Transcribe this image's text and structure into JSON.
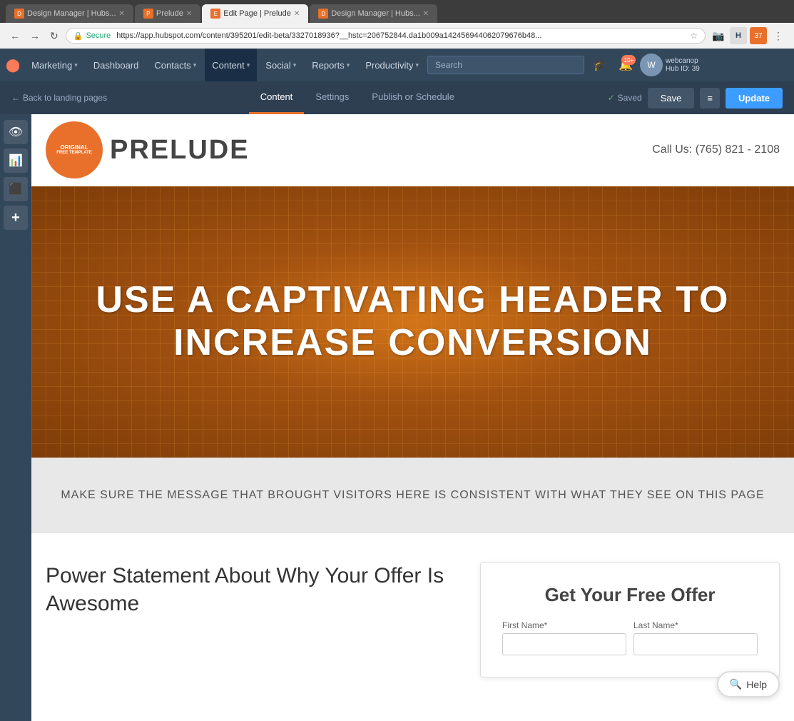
{
  "browser": {
    "tabs": [
      {
        "id": "tab1",
        "label": "Design Manager | Hubs...",
        "active": false,
        "favicon": "D"
      },
      {
        "id": "tab2",
        "label": "Prelude",
        "active": false,
        "favicon": "P"
      },
      {
        "id": "tab3",
        "label": "Edit Page | Prelude",
        "active": true,
        "favicon": "E"
      },
      {
        "id": "tab4",
        "label": "Design Manager | Hubs...",
        "active": false,
        "favicon": "D"
      }
    ],
    "address": {
      "secure_label": "Secure",
      "url": "https://app.hubspot.com/content/395201/edit-beta/3327018936?__hstc=206752844.da1b009a142456944062079676b48..."
    }
  },
  "nav": {
    "logo_symbol": "⬤",
    "items": [
      {
        "id": "marketing",
        "label": "Marketing",
        "has_dropdown": true
      },
      {
        "id": "dashboard",
        "label": "Dashboard",
        "has_dropdown": false
      },
      {
        "id": "contacts",
        "label": "Contacts",
        "has_dropdown": true
      },
      {
        "id": "content",
        "label": "Content",
        "has_dropdown": true,
        "active": true
      },
      {
        "id": "social",
        "label": "Social",
        "has_dropdown": true
      },
      {
        "id": "reports",
        "label": "Reports",
        "has_dropdown": true
      },
      {
        "id": "productivity",
        "label": "Productivity",
        "has_dropdown": true
      }
    ],
    "search_placeholder": "Search",
    "notifications_count": "10+",
    "user": {
      "hub_id": "Hub ID: 39",
      "username": "webcanop"
    }
  },
  "toolbar": {
    "back_label": "Back to landing pages",
    "tabs": [
      {
        "id": "content",
        "label": "Content",
        "active": true
      },
      {
        "id": "settings",
        "label": "Settings",
        "active": false
      },
      {
        "id": "publish",
        "label": "Publish or Schedule",
        "active": false
      }
    ],
    "saved_label": "Saved",
    "save_label": "Save",
    "options_icon": "≡",
    "update_label": "Update"
  },
  "sidebar": {
    "buttons": [
      {
        "id": "preview",
        "icon": "👁",
        "label": "Preview"
      },
      {
        "id": "stats",
        "icon": "📊",
        "label": "Stats"
      },
      {
        "id": "modules",
        "icon": "⬛",
        "label": "Modules"
      },
      {
        "id": "add",
        "icon": "+",
        "label": "Add"
      }
    ]
  },
  "page": {
    "header": {
      "logo_text": "PRELUDE",
      "badge_line1": "ORIGINAL",
      "badge_line2": "FREE TEMPLATE",
      "phone": "Call Us: (765) 821 - 2108"
    },
    "hero": {
      "heading_line1": "USE A CAPTIVATING HEADER TO",
      "heading_line2": "INCREASE CONVERSION"
    },
    "subhero": {
      "text": "MAKE SURE THE MESSAGE THAT BROUGHT VISITORS HERE IS CONSISTENT WITH WHAT THEY SEE ON THIS PAGE"
    },
    "power_statement": {
      "heading": "Power Statement About Why Your Offer Is Awesome"
    },
    "offer_form": {
      "title": "Get Your Free Offer",
      "first_name_label": "First Name*",
      "last_name_label": "Last Name*"
    }
  },
  "help": {
    "label": "Help"
  }
}
